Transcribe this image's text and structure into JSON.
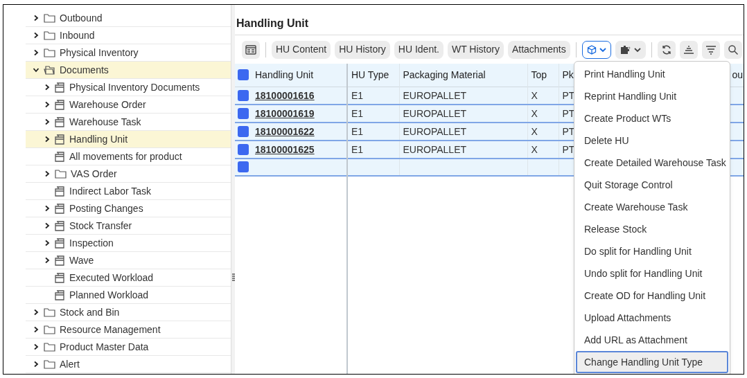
{
  "tree": [
    {
      "label": "Outbound",
      "kind": "folder",
      "expandable": true,
      "expanded": false,
      "selected": false
    },
    {
      "label": "Inbound",
      "kind": "folder",
      "expandable": true,
      "expanded": false,
      "selected": false
    },
    {
      "label": "Physical Inventory",
      "kind": "folder",
      "expandable": true,
      "expanded": false,
      "selected": false
    },
    {
      "label": "Documents",
      "kind": "folder",
      "expandable": true,
      "expanded": true,
      "selected": true,
      "children": [
        {
          "label": "Physical Inventory Documents",
          "kind": "tray",
          "expandable": true,
          "expanded": false,
          "selected": false
        },
        {
          "label": "Warehouse Order",
          "kind": "tray",
          "expandable": true,
          "expanded": false,
          "selected": false
        },
        {
          "label": "Warehouse Task",
          "kind": "tray",
          "expandable": true,
          "expanded": false,
          "selected": false
        },
        {
          "label": "Handling Unit",
          "kind": "tray",
          "expandable": true,
          "expanded": false,
          "selected": true
        },
        {
          "label": "All movements for product",
          "kind": "tray",
          "expandable": false,
          "expanded": false,
          "selected": false
        },
        {
          "label": "VAS Order",
          "kind": "folder",
          "expandable": true,
          "expanded": false,
          "selected": false
        },
        {
          "label": "Indirect Labor Task",
          "kind": "tray",
          "expandable": false,
          "expanded": false,
          "selected": false
        },
        {
          "label": "Posting Changes",
          "kind": "tray",
          "expandable": true,
          "expanded": false,
          "selected": false
        },
        {
          "label": "Stock Transfer",
          "kind": "tray",
          "expandable": true,
          "expanded": false,
          "selected": false
        },
        {
          "label": "Inspection",
          "kind": "tray",
          "expandable": true,
          "expanded": false,
          "selected": false
        },
        {
          "label": "Wave",
          "kind": "tray",
          "expandable": true,
          "expanded": false,
          "selected": false
        },
        {
          "label": "Executed Workload",
          "kind": "tray",
          "expandable": false,
          "expanded": false,
          "selected": false
        },
        {
          "label": "Planned Workload",
          "kind": "tray",
          "expandable": false,
          "expanded": false,
          "selected": false
        }
      ]
    },
    {
      "label": "Stock and Bin",
      "kind": "folder",
      "expandable": true,
      "expanded": false,
      "selected": false
    },
    {
      "label": "Resource Management",
      "kind": "folder",
      "expandable": true,
      "expanded": false,
      "selected": false
    },
    {
      "label": "Product Master Data",
      "kind": "folder",
      "expandable": true,
      "expanded": false,
      "selected": false
    },
    {
      "label": "Alert",
      "kind": "folder",
      "expandable": true,
      "expanded": false,
      "selected": false
    }
  ],
  "panel_title": "Handling Unit",
  "toolbar": [
    {
      "kind": "layout"
    },
    {
      "kind": "separator"
    },
    {
      "kind": "text",
      "label": "HU Content"
    },
    {
      "kind": "text",
      "label": "HU History"
    },
    {
      "kind": "text",
      "label": "HU Ident."
    },
    {
      "kind": "text",
      "label": "WT History"
    },
    {
      "kind": "text",
      "label": "Attachments"
    },
    {
      "kind": "separator"
    },
    {
      "kind": "cube",
      "active": true
    },
    {
      "kind": "puzzle",
      "active": false
    },
    {
      "kind": "separator"
    },
    {
      "kind": "refresh"
    },
    {
      "kind": "sort"
    },
    {
      "kind": "filter"
    },
    {
      "kind": "search"
    }
  ],
  "table": {
    "columns": [
      "Handling Unit",
      "HU Type",
      "Packaging Material",
      "Top",
      "Pk",
      "ou"
    ],
    "rows": [
      {
        "cells": [
          "18100001616",
          "E1",
          "EUROPALLET",
          "X",
          "PT"
        ]
      },
      {
        "cells": [
          "18100001619",
          "E1",
          "EUROPALLET",
          "X",
          "PT"
        ]
      },
      {
        "cells": [
          "18100001622",
          "E1",
          "EUROPALLET",
          "X",
          "PT"
        ]
      },
      {
        "cells": [
          "18100001625",
          "E1",
          "EUROPALLET",
          "X",
          "PT"
        ]
      },
      {
        "cells": []
      }
    ]
  },
  "menu": [
    {
      "label": "Print Handling Unit",
      "selected": false
    },
    {
      "label": "Reprint Handling Unit",
      "selected": false
    },
    {
      "label": "Create Product WTs",
      "selected": false
    },
    {
      "label": "Delete HU",
      "selected": false
    },
    {
      "label": "Create Detailed Warehouse Task",
      "selected": false
    },
    {
      "label": "Quit Storage Control",
      "selected": false
    },
    {
      "label": "Create Warehouse Task",
      "selected": false
    },
    {
      "label": "Release Stock",
      "selected": false
    },
    {
      "label": "Do split for Handling Unit",
      "selected": false
    },
    {
      "label": "Undo split for Handling Unit",
      "selected": false
    },
    {
      "label": "Create OD for Handling Unit",
      "selected": false
    },
    {
      "label": "Upload Attachments",
      "selected": false
    },
    {
      "label": "Add URL as Attachment",
      "selected": false
    },
    {
      "label": "Change Handling Unit Type",
      "selected": true
    }
  ]
}
